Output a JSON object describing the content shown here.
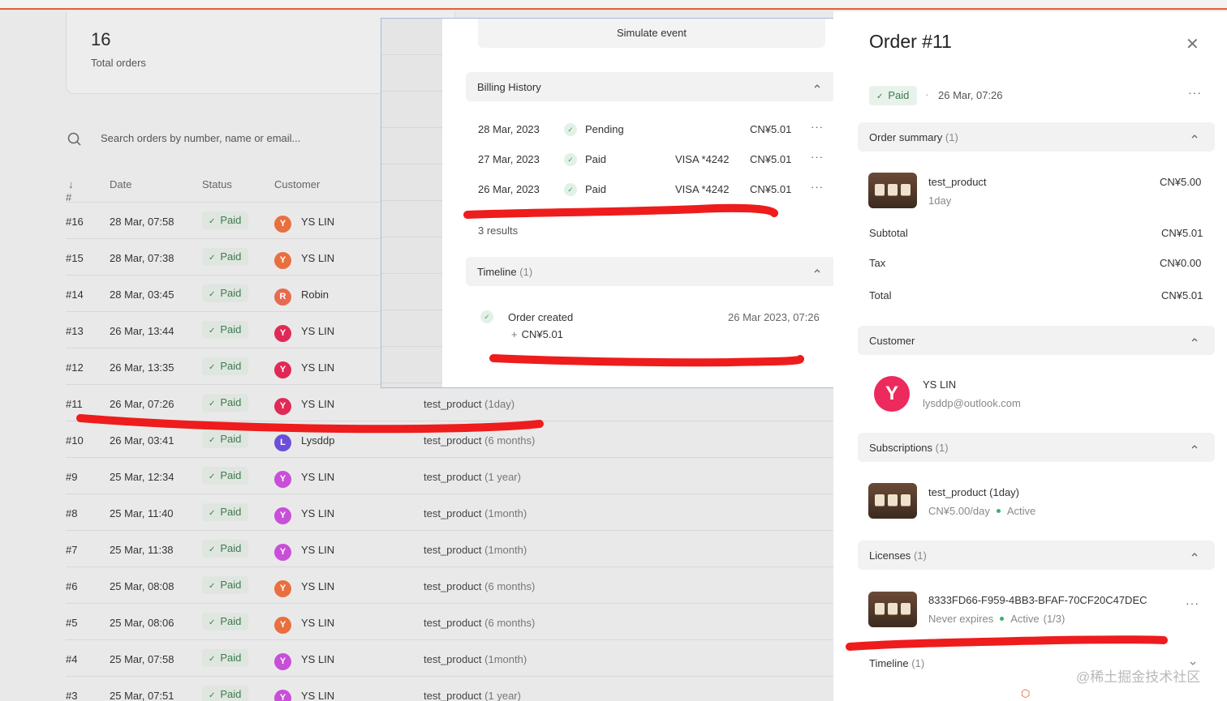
{
  "stats": {
    "total": "16",
    "total_label": "Total orders"
  },
  "search": {
    "placeholder": "Search orders by number, name or email..."
  },
  "table": {
    "headers": {
      "num": "#",
      "date": "Date",
      "status": "Status",
      "customer": "Customer"
    },
    "rows": [
      {
        "num": "#16",
        "date": "28 Mar, 07:58",
        "status": "Paid",
        "initial": "Y",
        "customer": "YS LIN",
        "color": "#e8703f",
        "product": "",
        "plan": ""
      },
      {
        "num": "#15",
        "date": "28 Mar, 07:38",
        "status": "Paid",
        "initial": "Y",
        "customer": "YS LIN",
        "color": "#e8703f",
        "product": "",
        "plan": ""
      },
      {
        "num": "#14",
        "date": "28 Mar, 03:45",
        "status": "Paid",
        "initial": "R",
        "customer": "Robin",
        "color": "#e86a4f",
        "product": "",
        "plan": ""
      },
      {
        "num": "#13",
        "date": "26 Mar, 13:44",
        "status": "Paid",
        "initial": "Y",
        "customer": "YS LIN",
        "color": "#e02a55",
        "product": "",
        "plan": ""
      },
      {
        "num": "#12",
        "date": "26 Mar, 13:35",
        "status": "Paid",
        "initial": "Y",
        "customer": "YS LIN",
        "color": "#e02a55",
        "product": "",
        "plan": ""
      },
      {
        "num": "#11",
        "date": "26 Mar, 07:26",
        "status": "Paid",
        "initial": "Y",
        "customer": "YS LIN",
        "color": "#e02a55",
        "product": "test_product",
        "plan": "(1day)"
      },
      {
        "num": "#10",
        "date": "26 Mar, 03:41",
        "status": "Paid",
        "initial": "L",
        "customer": "Lysddp",
        "color": "#6b4fd8",
        "product": "test_product",
        "plan": "(6 months)"
      },
      {
        "num": "#9",
        "date": "25 Mar, 12:34",
        "status": "Paid",
        "initial": "Y",
        "customer": "YS LIN",
        "color": "#c84fd8",
        "product": "test_product",
        "plan": "(1 year)"
      },
      {
        "num": "#8",
        "date": "25 Mar, 11:40",
        "status": "Paid",
        "initial": "Y",
        "customer": "YS LIN",
        "color": "#c84fd8",
        "product": "test_product",
        "plan": "(1month)"
      },
      {
        "num": "#7",
        "date": "25 Mar, 11:38",
        "status": "Paid",
        "initial": "Y",
        "customer": "YS LIN",
        "color": "#c84fd8",
        "product": "test_product",
        "plan": "(1month)"
      },
      {
        "num": "#6",
        "date": "25 Mar, 08:08",
        "status": "Paid",
        "initial": "Y",
        "customer": "YS LIN",
        "color": "#e8703f",
        "product": "test_product",
        "plan": "(6 months)"
      },
      {
        "num": "#5",
        "date": "25 Mar, 08:06",
        "status": "Paid",
        "initial": "Y",
        "customer": "YS LIN",
        "color": "#e8703f",
        "product": "test_product",
        "plan": "(6 months)"
      },
      {
        "num": "#4",
        "date": "25 Mar, 07:58",
        "status": "Paid",
        "initial": "Y",
        "customer": "YS LIN",
        "color": "#c84fd8",
        "product": "test_product",
        "plan": "(1month)"
      },
      {
        "num": "#3",
        "date": "25 Mar, 07:51",
        "status": "Paid",
        "initial": "Y",
        "customer": "YS LIN",
        "color": "#c84fd8",
        "product": "test_product",
        "plan": "(1 year)"
      }
    ]
  },
  "modal": {
    "simulate_label": "Simulate event",
    "billing_title": "Billing History",
    "billing_rows": [
      {
        "date": "28 Mar, 2023",
        "status": "Pending",
        "card": "",
        "amount": "CN¥5.01"
      },
      {
        "date": "27 Mar, 2023",
        "status": "Paid",
        "card": "VISA *4242",
        "amount": "CN¥5.01"
      },
      {
        "date": "26 Mar, 2023",
        "status": "Paid",
        "card": "VISA *4242",
        "amount": "CN¥5.01"
      }
    ],
    "results": "3 results",
    "timeline_title": "Timeline",
    "timeline_count": "(1)",
    "event_title": "Order created",
    "event_amount": "CN¥5.01",
    "event_time": "26 Mar 2023, 07:26"
  },
  "drawer": {
    "title": "Order #11",
    "status": "Paid",
    "date": "26 Mar, 07:26",
    "summary_title": "Order summary",
    "summary_count": "(1)",
    "product_name": "test_product",
    "product_plan": "1day",
    "product_price": "CN¥5.00",
    "subtotal_label": "Subtotal",
    "subtotal": "CN¥5.01",
    "tax_label": "Tax",
    "tax": "CN¥0.00",
    "total_label": "Total",
    "total": "CN¥5.01",
    "customer_title": "Customer",
    "customer_initial": "Y",
    "customer_name": "YS LIN",
    "customer_email": "lysddp@outlook.com",
    "subs_title": "Subscriptions",
    "subs_count": "(1)",
    "sub_name": "test_product (1day)",
    "sub_price": "CN¥5.00/day",
    "sub_status": "Active",
    "lic_title": "Licenses",
    "lic_count": "(1)",
    "lic_key": "8333FD66-F959-4BB3-BFAF-70CF20C47DEC",
    "lic_expiry": "Never expires",
    "lic_status": "Active",
    "lic_usage": "(1/3)",
    "timeline_title": "Timeline",
    "timeline_count": "(1)"
  },
  "watermark": "@稀土掘金技术社区",
  "colors": {
    "accent_red": "#ee1c1c",
    "paid_green": "#3d7a4f",
    "avatar_pink": "#ec2a5d"
  }
}
